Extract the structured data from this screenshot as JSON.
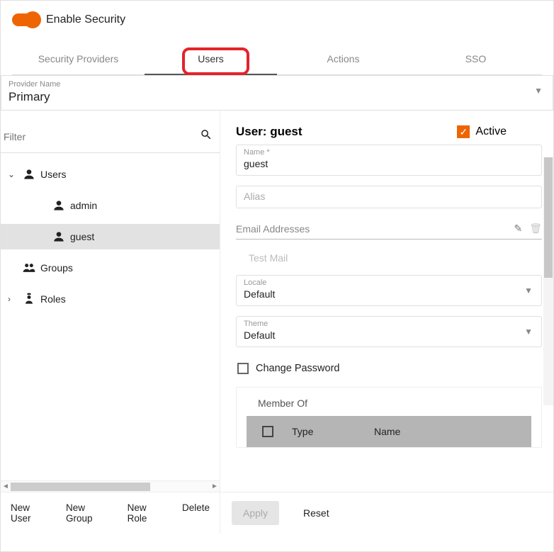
{
  "header": {
    "toggle_label": "Enable Security",
    "toggle_on": true
  },
  "tabs": [
    "Security Providers",
    "Users",
    "Actions",
    "SSO"
  ],
  "active_tab": 1,
  "provider": {
    "label": "Provider Name",
    "value": "Primary"
  },
  "filter": {
    "placeholder": "Filter"
  },
  "tree": {
    "users_label": "Users",
    "users_expanded": true,
    "users_children": [
      "admin",
      "guest"
    ],
    "selected": "guest",
    "groups_label": "Groups",
    "roles_label": "Roles",
    "roles_expanded": false
  },
  "left_actions": [
    "New User",
    "New Group",
    "New Role",
    "Delete"
  ],
  "detail": {
    "title_prefix": "User: ",
    "title_name": "guest",
    "active_label": "Active",
    "active_checked": true,
    "name": {
      "label": "Name *",
      "value": "guest"
    },
    "alias": {
      "label": "Alias",
      "value": ""
    },
    "email_label": "Email Addresses",
    "test_mail_label": "Test Mail",
    "locale": {
      "label": "Locale",
      "value": "Default"
    },
    "theme": {
      "label": "Theme",
      "value": "Default"
    },
    "change_pw_label": "Change Password",
    "change_pw_checked": false,
    "member_of": {
      "title": "Member Of",
      "cols": [
        "Type",
        "Name"
      ]
    }
  },
  "footer": {
    "apply": "Apply",
    "reset": "Reset"
  }
}
